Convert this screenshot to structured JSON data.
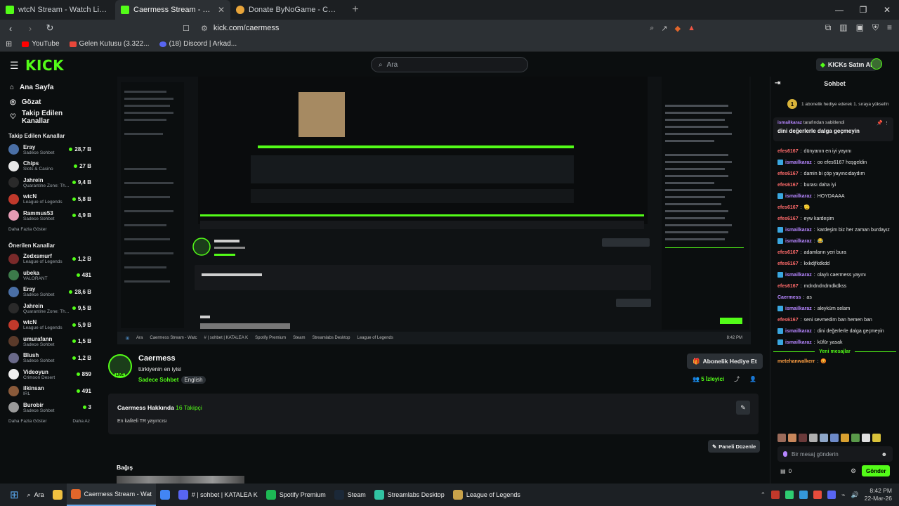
{
  "browser": {
    "tabs": [
      {
        "title": "wtcN Stream - Watch Live on Kick",
        "favicon_color": "#53fc18"
      },
      {
        "title": "Caermess Stream - Watch Live on Kick",
        "favicon_color": "#53fc18",
        "active": true
      },
      {
        "title": "Donate ByNoGame - Caermess",
        "favicon_color": "#e8a43a"
      }
    ],
    "url": "kick.com/caermess",
    "bookmarks": [
      "YouTube",
      "Gelen Kutusu (3.322...",
      "(18) Discord | Arkad..."
    ]
  },
  "header": {
    "logo": "KICK",
    "search_placeholder": "Ara",
    "kicks_button": "KICKs Satın Al"
  },
  "sidebar": {
    "nav": [
      {
        "label": "Ana Sayfa",
        "icon": "home-icon"
      },
      {
        "label": "Gözat",
        "icon": "compass-icon"
      },
      {
        "label": "Takip Edilen Kanallar",
        "icon": "heart-icon"
      }
    ],
    "followed_title": "Takip Edilen Kanallar",
    "followed": [
      {
        "name": "Eray",
        "category": "Sadece Sohbet",
        "viewers": "28,7 B",
        "color": "#4a6fa5"
      },
      {
        "name": "Chips",
        "category": "Slots & Casino",
        "viewers": "27 B",
        "color": "#e7e7e7"
      },
      {
        "name": "Jahrein",
        "category": "Quarantine Zone: Th...",
        "viewers": "9,4 B",
        "color": "#2a2a2a"
      },
      {
        "name": "wtcN",
        "category": "League of Legends",
        "viewers": "5,8 B",
        "color": "#c0392b"
      },
      {
        "name": "Rammus53",
        "category": "Sadece Sohbet",
        "viewers": "4,9 B",
        "color": "#e59bb4"
      }
    ],
    "followed_more": "Daha Fazla Göster",
    "recommended_title": "Önerilen Kanallar",
    "recommended": [
      {
        "name": "Zedxsmurf",
        "category": "League of Legends",
        "viewers": "1,2 B",
        "color": "#7a2a2a"
      },
      {
        "name": "ubeka",
        "category": "VALORANT",
        "viewers": "481",
        "color": "#3c7a4a"
      },
      {
        "name": "Eray",
        "category": "Sadece Sohbet",
        "viewers": "28,6 B",
        "color": "#4a6fa5"
      },
      {
        "name": "Jahrein",
        "category": "Quarantine Zone: Th...",
        "viewers": "9,5 B",
        "color": "#2a2a2a"
      },
      {
        "name": "wtcN",
        "category": "League of Legends",
        "viewers": "5,9 B",
        "color": "#c0392b"
      },
      {
        "name": "umurafann",
        "category": "Sadece Sohbet",
        "viewers": "1,5 B",
        "color": "#5a3a2a"
      },
      {
        "name": "Blush",
        "category": "Sadece Sohbet",
        "viewers": "1,2 B",
        "color": "#6a6a8a"
      },
      {
        "name": "Videoyun",
        "category": "Crimson Desert",
        "viewers": "859",
        "color": "#f0f0f0"
      },
      {
        "name": "ilkinsan",
        "category": "IRL",
        "viewers": "491",
        "color": "#8a5a3a"
      },
      {
        "name": "Burobir",
        "category": "Sadece Sohbet",
        "viewers": "3",
        "color": "#9a9a9a"
      }
    ],
    "recommended_more": "Daha Fazla Göster",
    "less": "Daha Az"
  },
  "channel": {
    "name": "Caermess",
    "stream_title": "türkiyenin en iyisi",
    "category": "Sadece Sohbet",
    "language": "English",
    "live": "LIVE",
    "subscribe": "Abonelik Hediye Et",
    "viewers": "5 İzleyici",
    "about_title": "Caermess Hakkında",
    "followers": "16 Takipçi",
    "about_text": "En kaliteli TR yayıncısı",
    "edit_panels": "Paneli Düzenle",
    "donate_title": "Bağış"
  },
  "video": {
    "taskbar_items": [
      "Ara",
      "Caermess Stream - Watc",
      "# | sohbet | KATALEA K",
      "Spotify Premium",
      "Steam",
      "Streamlabs Desktop",
      "League of Legends"
    ],
    "clock": "8:42 PM"
  },
  "chat": {
    "title": "Sohbet",
    "gift_text": "1 abonelik hediye ederek 1. sıraya yüksel!n",
    "pinned_by": "ismailkaraz",
    "pinned_by_suffix": "tarafından sabitlendi",
    "pinned_message": "dini değerlerle dalga geçmeyin",
    "messages": [
      {
        "user": "efes6167",
        "text": "dünyanın en iyi yayını",
        "color": "#ff6b6b",
        "badge": false
      },
      {
        "user": "ismailkaraz",
        "text": "oo efes6167 hoşgeldin",
        "color": "#b686ff",
        "badge": true
      },
      {
        "user": "efes6167",
        "text": "damin bi çöp yayıncıdaydım",
        "color": "#ff6b6b",
        "badge": false
      },
      {
        "user": "efes6167",
        "text": "burası daha iyi",
        "color": "#ff6b6b",
        "badge": false
      },
      {
        "user": "ismailkaraz",
        "text": "HOYDAAAA",
        "color": "#b686ff",
        "badge": true
      },
      {
        "user": "efes6167",
        "text": "🫡",
        "color": "#ff6b6b",
        "badge": false
      },
      {
        "user": "efes6167",
        "text": "eyw kardeşim",
        "color": "#ff6b6b",
        "badge": false
      },
      {
        "user": "ismailkaraz",
        "text": "kardeşim biz her zaman burdayız",
        "color": "#b686ff",
        "badge": true
      },
      {
        "user": "ismailkaraz",
        "text": "😂",
        "color": "#b686ff",
        "badge": true
      },
      {
        "user": "efes6167",
        "text": "adamların yeri bura",
        "color": "#ff6b6b",
        "badge": false
      },
      {
        "user": "efes6167",
        "text": "kxkdjfkdkdd",
        "color": "#ff6b6b",
        "badge": false
      },
      {
        "user": "ismailkaraz",
        "text": "olaylı caermess yayını",
        "color": "#b686ff",
        "badge": true
      },
      {
        "user": "efes6167",
        "text": "mdndndndmdkdkss",
        "color": "#ff6b6b",
        "badge": false
      },
      {
        "user": "Caermess",
        "text": "as",
        "color": "#b686ff",
        "badge": false
      },
      {
        "user": "ismailkaraz",
        "text": "aleyküm selam",
        "color": "#b686ff",
        "badge": true
      },
      {
        "user": "efes6167",
        "text": "seni sevmedim ban hemen ban",
        "color": "#ff6b6b",
        "badge": false
      },
      {
        "user": "ismailkaraz",
        "text": "dini değerlerle dalga geçmeyin",
        "color": "#b686ff",
        "badge": true
      },
      {
        "user": "ismailkaraz",
        "text": "küfür yasak",
        "color": "#b686ff",
        "badge": true
      }
    ],
    "new_messages": "Yeni mesajlar",
    "last_user": "metehanwalkerr",
    "last_text": "😡",
    "input_placeholder": "Bir mesaj gönderin",
    "points": "0",
    "send": "Gönder"
  },
  "taskbar": {
    "search": "Ara",
    "items": [
      {
        "label": "Caermess Stream - Wat",
        "color": "#e0662b",
        "active": true
      },
      {
        "label": "",
        "color": "#4285f4"
      },
      {
        "label": "# | sohbet | KATALEA K",
        "color": "#5865f2"
      },
      {
        "label": "Spotify Premium",
        "color": "#1db954"
      },
      {
        "label": "Steam",
        "color": "#1b2838"
      },
      {
        "label": "Streamlabs Desktop",
        "color": "#31c3a2"
      },
      {
        "label": "League of Legends",
        "color": "#c8a24a"
      }
    ],
    "time": "8:42 PM",
    "date": "22-Mar-26"
  }
}
